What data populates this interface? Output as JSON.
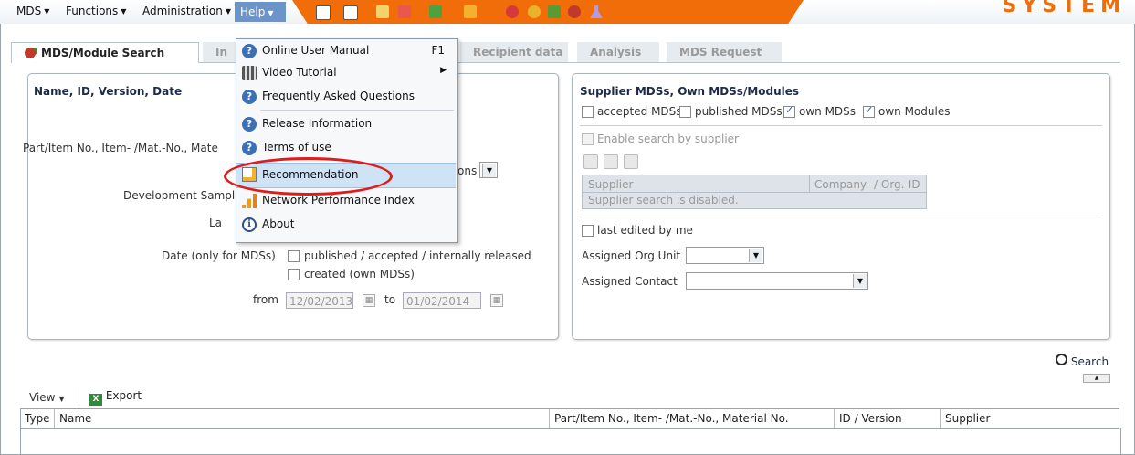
{
  "menubar": {
    "items": [
      {
        "label": "MDS"
      },
      {
        "label": "Functions"
      },
      {
        "label": "Administration"
      }
    ],
    "help_label": "Help",
    "brand": "SYSTEM"
  },
  "tabs": [
    {
      "label": "MDS/Module Search",
      "active": true
    },
    {
      "label": "In"
    },
    {
      "label": "Recipient data"
    },
    {
      "label": "Analysis"
    },
    {
      "label": "MDS Request"
    }
  ],
  "left_panel": {
    "title": "Name, ID, Version, Date",
    "part_label": "Part/Item No., Item- /Mat.-No., Mate",
    "options_fragment": "ons",
    "dev_sample_label": "Development Sample",
    "lang_fragment": "La",
    "date_label": "Date (only for MDSs)",
    "date_option1": "published / accepted / internally released",
    "date_option2": "created (own MDSs)",
    "from_label": "from",
    "from_value": "12/02/2013",
    "to_label": "to",
    "to_value": "01/02/2014"
  },
  "right_panel": {
    "title": "Supplier MDSs, Own MDSs/Modules",
    "filters": [
      {
        "label": "accepted MDSs",
        "checked": false
      },
      {
        "label": "published MDSs",
        "checked": false
      },
      {
        "label": "own MDSs",
        "checked": true
      },
      {
        "label": "own Modules",
        "checked": true
      }
    ],
    "enable_supplier_label": "Enable search by supplier",
    "supplier_col": "Supplier",
    "company_col": "Company- / Org.-ID",
    "supplier_disabled_text": "Supplier search is disabled.",
    "last_edited_label": "last edited by me",
    "org_unit_label": "Assigned Org Unit",
    "contact_label": "Assigned Contact"
  },
  "search": {
    "label": "Search"
  },
  "results": {
    "view_label": "View",
    "export_label": "Export",
    "columns": [
      "Type",
      "Name",
      "Part/Item No., Item- /Mat.-No., Material No.",
      "ID / Version",
      "Supplier"
    ]
  },
  "help_menu": {
    "items": [
      {
        "label": "Online User Manual",
        "shortcut": "F1"
      },
      {
        "label": "Video Tutorial"
      },
      {
        "label": "Frequently Asked Questions"
      },
      {
        "label": "Release Information"
      },
      {
        "label": "Terms of use"
      },
      {
        "label": "Recommendation"
      },
      {
        "label": "Network Performance Index"
      },
      {
        "label": "About"
      }
    ]
  },
  "colors": {
    "accent_orange": "#f06d0a",
    "menu_highlight": "#6b95c8",
    "panel_title": "#1e2b48",
    "highlight_ring": "#e01b1b"
  }
}
